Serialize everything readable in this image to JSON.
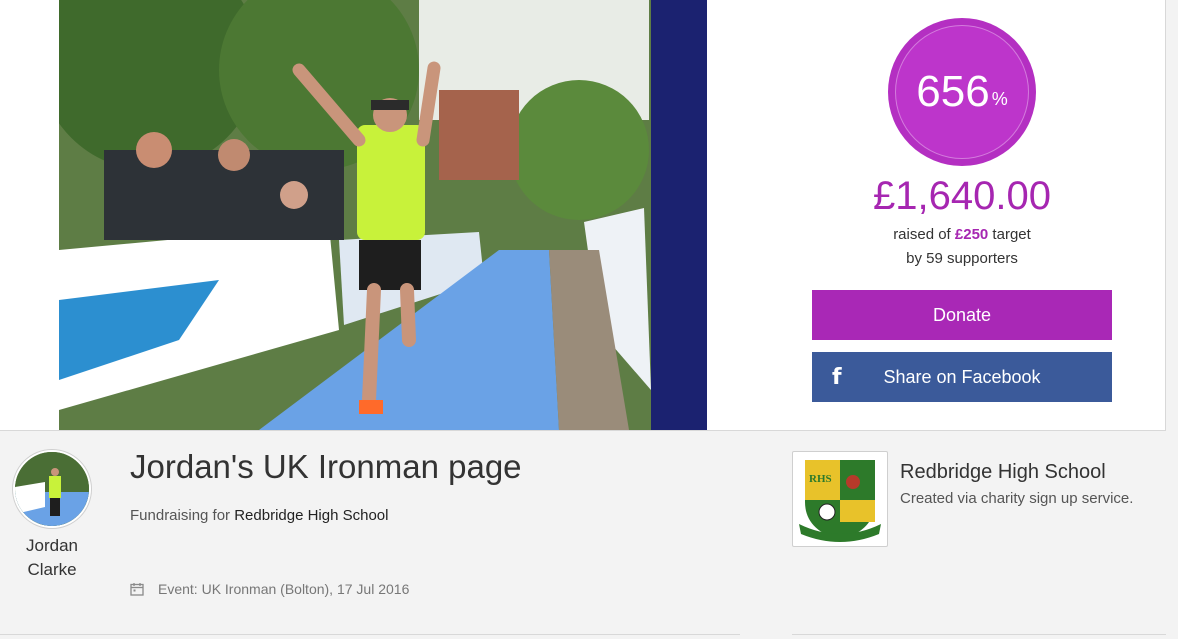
{
  "progress": {
    "percent": "656",
    "percent_sign": "%",
    "raised_amount": "£1,640.00",
    "target_prefix": "raised of ",
    "target_amount": "£250",
    "target_suffix": " target",
    "supporters_prefix": "by ",
    "supporters_count": "59",
    "supporters_suffix": " supporters"
  },
  "actions": {
    "donate_label": "Donate",
    "share_label": "Share on Facebook",
    "share_icon": "facebook-icon"
  },
  "fundraiser": {
    "first_name": "Jordan",
    "last_name": "Clarke"
  },
  "page": {
    "title": "Jordan's UK Ironman page",
    "fundraising_prefix": "Fundraising for ",
    "fundraising_charity": "Redbridge High School",
    "event_text": "Event: UK Ironman (Bolton), 17 Jul 2016"
  },
  "charity": {
    "name": "Redbridge High School",
    "subtitle": "Created via charity sign up service."
  },
  "colors": {
    "accent": "#a928b6",
    "facebook": "#3b5a9a"
  }
}
